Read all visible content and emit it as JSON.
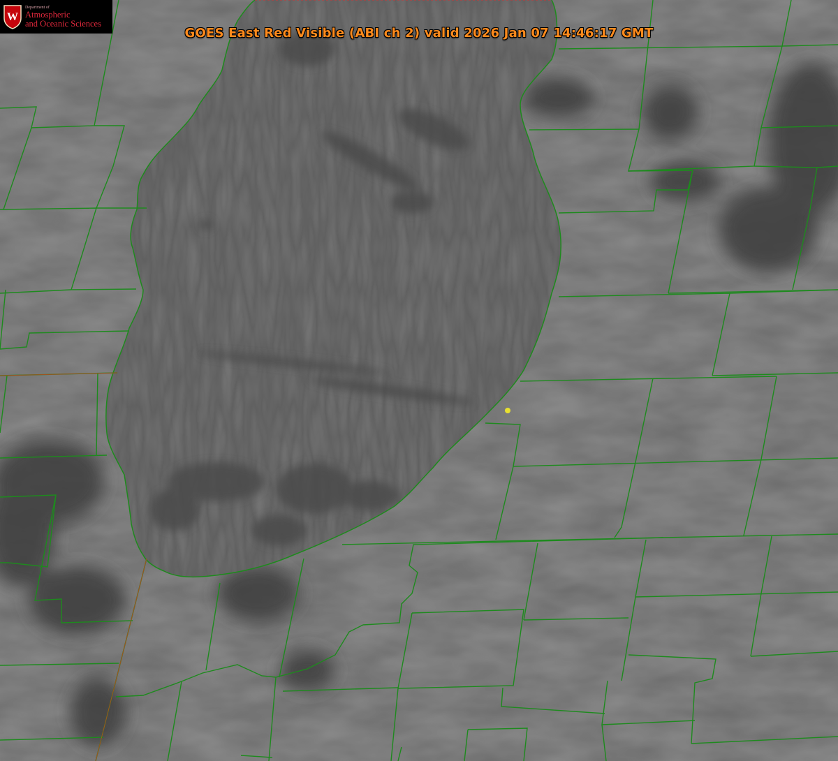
{
  "title": "GOES East Red Visible (ABI ch 2) valid 2026 Jan 07 14:46:17 GMT",
  "logo": {
    "crest_letter": "W",
    "department_line": "Department of",
    "name_line1": "Atmospheric",
    "name_line2": "and Oceanic Sciences"
  },
  "colors": {
    "county_lines": "#1e8a1e",
    "shoreline_overlay": "#d83030",
    "site_marker": "#e8e030",
    "title_text": "#ff8a1c",
    "logo_text": "#e0283c",
    "land_gray": "#6a6a6a",
    "lake_gray": "#5f5f5f",
    "cloud_dark": "#464646"
  },
  "map": {
    "projection_region": "Lake Michigan region",
    "water_body_visible": "Lake Michigan",
    "features": [
      "county-boundaries",
      "state-boundary",
      "lake-shoreline",
      "site-marker"
    ]
  }
}
